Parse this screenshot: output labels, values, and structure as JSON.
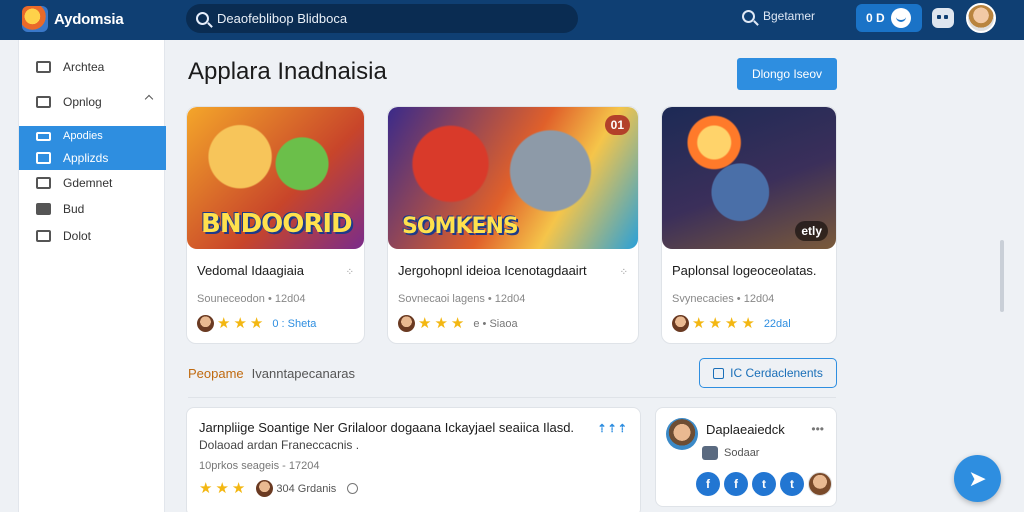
{
  "app": {
    "name": "Aydomsia"
  },
  "search": {
    "value": "Deaofeblibop Blidboca"
  },
  "topbar": {
    "search_label": "Bgetamer",
    "pill_label": "0 D",
    "colors": {
      "bar": "#0f3f73",
      "accent": "#2e8ee0"
    }
  },
  "sidebar": {
    "items": [
      {
        "label": "Archtea",
        "icon": "tools-icon"
      },
      {
        "label": "Opnlog",
        "icon": "image-icon"
      },
      {
        "label": "Apodies",
        "icon": "edit-icon"
      },
      {
        "label": "Applizds",
        "icon": "list-icon"
      },
      {
        "label": "Gdemnet",
        "icon": "shuffle-icon"
      },
      {
        "label": "Bud",
        "icon": "folder-icon"
      },
      {
        "label": "Dolot",
        "icon": "photo-icon"
      }
    ],
    "active_index": 3
  },
  "main": {
    "title": "Applara Inadnaisia",
    "primary_button": "Dlongo Iseov",
    "cards": [
      {
        "art_text": "BNDOORID",
        "title": "Vedomal Idaagiaia",
        "meta": "Souneceodon • 12d04",
        "rating_note": "0 : Sheta",
        "stars": 3
      },
      {
        "art_text": "SOMKENS",
        "badge": "01",
        "title": "Jergohopnl ideioa Icenotagdaairt",
        "meta": "Sovnecaoi lagens • 12d04",
        "rating_note": "e • Siaoa",
        "stars": 3
      },
      {
        "badge": "etly",
        "title": "Paplonsal logeoceolatas.",
        "meta": "Svynecacies • 12d04",
        "rating_note": "22dal",
        "stars": 4
      }
    ],
    "section": {
      "title": "Peopame",
      "subtitle": "Ivanntapecanaras",
      "button": "IC Cerdaclenents"
    },
    "list_item": {
      "title": "Jarnpliige Soantige Ner Grilaloor dogaana Ickayjael seaiica Ilasd.",
      "subtitle": "Dolaoad ardan Franeccacnis .",
      "meta": "10prkos seageis - 17204",
      "rating_note": "304 Grdanis",
      "stars": 3
    },
    "profile": {
      "name": "Daplaeaiedck",
      "sub": "Sodaar",
      "socials": [
        "f",
        "f",
        "t",
        "t"
      ]
    }
  },
  "fab": {
    "icon": "share-arrow-icon"
  }
}
